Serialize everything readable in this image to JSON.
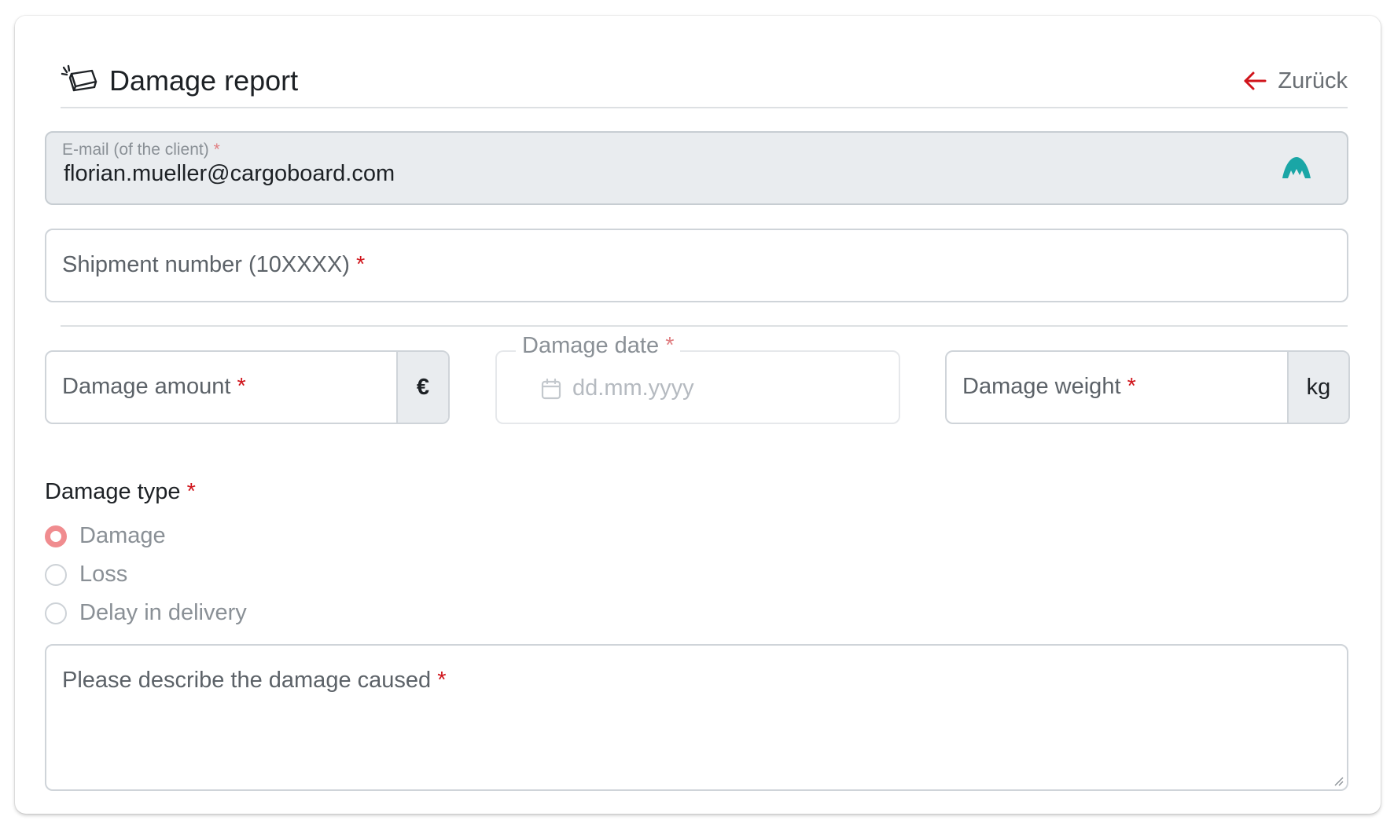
{
  "header": {
    "title": "Damage report",
    "back_label": "Zurück",
    "icon": "damaged-package-icon"
  },
  "form": {
    "email": {
      "label": "E-mail (of the client)",
      "required": "*",
      "value": "florian.mueller@cargoboard.com",
      "icon": "cargoboard-logo-icon"
    },
    "shipment_number": {
      "label": "Shipment number (10XXXX)",
      "required": "*"
    },
    "damage_amount": {
      "label": "Damage amount",
      "required": "*",
      "unit": "€"
    },
    "damage_date": {
      "label": "Damage date",
      "required": "*",
      "placeholder": "dd.mm.yyyy",
      "icon": "calendar-icon"
    },
    "damage_weight": {
      "label": "Damage weight",
      "required": "*",
      "unit": "kg"
    },
    "damage_type": {
      "label": "Damage type",
      "required": "*",
      "options": [
        "Damage",
        "Loss",
        "Delay in delivery"
      ],
      "selected": "Damage"
    },
    "description": {
      "label": "Please describe the damage caused",
      "required": "*"
    }
  },
  "colors": {
    "required": "#d0141b",
    "back_arrow": "#d0141b",
    "radio_selected": "#f08c8f",
    "logo": "#1aa6a6"
  }
}
